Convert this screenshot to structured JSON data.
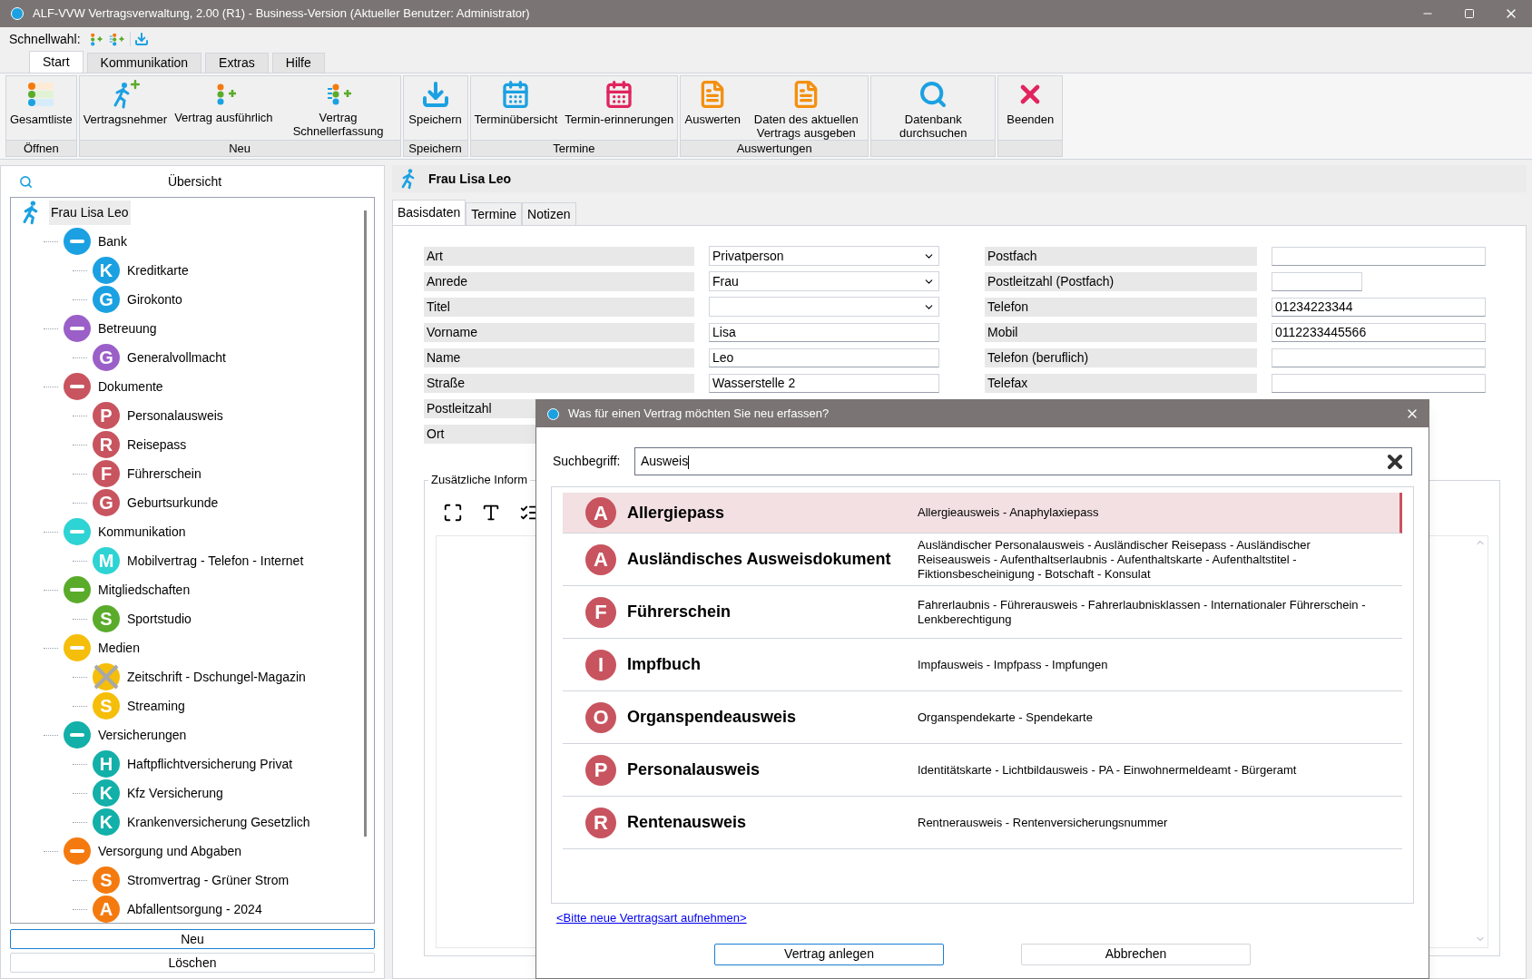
{
  "window": {
    "title": "ALF-VVW Vertragsverwaltung, 2.00 (R1) - Business-Version (Aktueller Benutzer: Administrator)"
  },
  "quickbar": {
    "label": "Schnellwahl:"
  },
  "ribbon_tabs": [
    {
      "label": "Start",
      "selected": true
    },
    {
      "label": "Kommunikation",
      "selected": false
    },
    {
      "label": "Extras",
      "selected": false
    },
    {
      "label": "Hilfe",
      "selected": false
    }
  ],
  "ribbon_groups": [
    {
      "label": "Öffnen",
      "buttons": [
        {
          "kind": "list",
          "label": "Gesamtliste"
        }
      ]
    },
    {
      "label": "Neu",
      "buttons": [
        {
          "kind": "person",
          "label": "Vertragsnehmer"
        },
        {
          "kind": "add",
          "label": "Vertrag ausführlich"
        },
        {
          "kind": "fastadd",
          "label": "Vertrag Schnellerfassung"
        }
      ]
    },
    {
      "label": "Speichern",
      "buttons": [
        {
          "kind": "save",
          "label": "Speichern"
        }
      ]
    },
    {
      "label": "Termine",
      "buttons": [
        {
          "kind": "calendar",
          "label": "Terminübersicht"
        },
        {
          "kind": "reminder",
          "label": "Termin-erinnerungen"
        }
      ]
    },
    {
      "label": "Auswertungen",
      "buttons": [
        {
          "kind": "doc",
          "label": "Auswerten"
        },
        {
          "kind": "doc",
          "label": "Daten des aktuellen Vertrags ausgeben"
        }
      ]
    },
    {
      "buttons": [
        {
          "kind": "search",
          "label": "Datenbank durchsuchen"
        }
      ]
    },
    {
      "buttons": [
        {
          "kind": "close",
          "label": "Beenden"
        }
      ]
    }
  ],
  "sidebar": {
    "title": "Übersicht",
    "root": {
      "label": "Frau Lisa Leo",
      "selected": true
    },
    "categories": [
      {
        "label": "Bank",
        "color": "#1ba1e2",
        "selected": false,
        "children": [
          {
            "letter": "K",
            "label": "Kreditkarte",
            "cancelled": false,
            "selected": false
          },
          {
            "letter": "G",
            "label": "Girokonto",
            "cancelled": false,
            "selected": false
          }
        ]
      },
      {
        "label": "Betreuung",
        "color": "#9b5fc8",
        "selected": false,
        "children": [
          {
            "letter": "G",
            "label": "Generalvollmacht",
            "cancelled": false,
            "selected": false
          }
        ]
      },
      {
        "label": "Dokumente",
        "color": "#c8545f",
        "selected": false,
        "children": [
          {
            "letter": "P",
            "label": "Personalausweis",
            "cancelled": false,
            "selected": false
          },
          {
            "letter": "R",
            "label": "Reisepass",
            "cancelled": false,
            "selected": false
          },
          {
            "letter": "F",
            "label": "Führerschein",
            "cancelled": false,
            "selected": false
          },
          {
            "letter": "G",
            "label": "Geburtsurkunde",
            "cancelled": false,
            "selected": false
          }
        ]
      },
      {
        "label": "Kommunikation",
        "color": "#2ed3d3",
        "selected": false,
        "children": [
          {
            "letter": "M",
            "label": "Mobilvertrag - Telefon - Internet",
            "cancelled": false,
            "selected": false
          }
        ]
      },
      {
        "label": "Mitgliedschaften",
        "color": "#5aab2a",
        "selected": false,
        "children": [
          {
            "letter": "S",
            "label": "Sportstudio",
            "cancelled": false,
            "selected": false
          }
        ]
      },
      {
        "label": "Medien",
        "color": "#f5be0a",
        "selected": false,
        "children": [
          {
            "label": "Zeitschrift - Dschungel-Magazin",
            "cancelled": true,
            "selected": false
          },
          {
            "letter": "S",
            "label": "Streaming",
            "cancelled": false,
            "selected": false
          }
        ]
      },
      {
        "label": "Versicherungen",
        "color": "#12b0a8",
        "selected": false,
        "children": [
          {
            "letter": "H",
            "label": "Haftpflichtversicherung Privat",
            "cancelled": false,
            "selected": false
          },
          {
            "letter": "K",
            "label": "Kfz Versicherung",
            "cancelled": false,
            "selected": false
          },
          {
            "letter": "K",
            "label": "Krankenversicherung Gesetzlich",
            "cancelled": false,
            "selected": false
          }
        ]
      },
      {
        "label": "Versorgung und Abgaben",
        "color": "#f47a0f",
        "selected": false,
        "children": [
          {
            "letter": "S",
            "label": "Stromvertrag - Grüner Strom",
            "cancelled": false,
            "selected": false
          },
          {
            "letter": "A",
            "label": "Abfallentsorgung - 2024",
            "cancelled": false,
            "selected": false
          }
        ]
      }
    ],
    "buttons": [
      "Neu",
      "Löschen"
    ]
  },
  "detail": {
    "title": "Frau Lisa Leo",
    "tabs": [
      {
        "label": "Basisdaten",
        "selected": true
      },
      {
        "label": "Termine",
        "selected": false
      },
      {
        "label": "Notizen",
        "selected": false
      }
    ],
    "left_fields": [
      {
        "label": "Art",
        "kind": "combo",
        "value": "Privatperson"
      },
      {
        "label": "Anrede",
        "kind": "combo",
        "value": "Frau"
      },
      {
        "label": "Titel",
        "kind": "combo"
      },
      {
        "label": "Vorname",
        "kind": "text",
        "value": "Lisa"
      },
      {
        "label": "Name",
        "kind": "text",
        "value": "Leo"
      },
      {
        "label": "Straße",
        "kind": "text",
        "value": "Wasserstelle 2"
      },
      {
        "label": "Postleitzahl",
        "kind": "hidden"
      },
      {
        "label": "Ort",
        "kind": "hidden"
      }
    ],
    "right_fields": [
      {
        "label": "Postfach",
        "kind": "text"
      },
      {
        "label": "Postleitzahl (Postfach)",
        "kind": "short"
      },
      {
        "label": "Telefon",
        "kind": "text",
        "value": "01234223344"
      },
      {
        "label": "Mobil",
        "kind": "text",
        "value": "0112233445566"
      },
      {
        "label": "Telefon (beruflich)",
        "kind": "text"
      },
      {
        "label": "Telefax",
        "kind": "text"
      }
    ],
    "notes_group": "Zusätzliche Inform"
  },
  "dialog": {
    "title": "Was für einen Vertrag möchten Sie neu erfassen?",
    "search_label": "Suchbegriff:",
    "search_value": "Ausweis",
    "results": [
      {
        "letter": "A",
        "name": "Allergiepass",
        "synonyms": "Allergieausweis - Anaphylaxiepass",
        "selected": true
      },
      {
        "letter": "A",
        "name": "Ausländisches Ausweisdokument",
        "synonyms": "Ausländischer Personalausweis - Ausländischer Reisepass - Ausländischer Reiseausweis - Aufenthaltserlaubnis - Aufenthaltskarte - Aufenthaltstitel - Fiktionsbescheinigung - Botschaft - Konsulat",
        "selected": false
      },
      {
        "letter": "F",
        "name": "Führerschein",
        "synonyms": "Fahrerlaubnis - Führerausweis - Fahrerlaubnisklassen - Internationaler Führerschein - Lenkberechtigung",
        "selected": false
      },
      {
        "letter": "I",
        "name": "Impfbuch",
        "synonyms": "Impfausweis - Impfpass - Impfungen",
        "selected": false
      },
      {
        "letter": "O",
        "name": "Organspendeausweis",
        "synonyms": "Organspendekarte - Spendekarte",
        "selected": false
      },
      {
        "letter": "P",
        "name": "Personalausweis",
        "synonyms": "Identitätskarte - Lichtbildausweis - PA - Einwohnermeldeamt - Bürgeramt",
        "selected": false
      },
      {
        "letter": "R",
        "name": "Rentenausweis",
        "synonyms": "Rentnerausweis - Rentenversicherungsnummer",
        "selected": false
      }
    ],
    "link": "<Bitte neue Vertragsart aufnehmen>",
    "buttons": [
      "Vertrag anlegen",
      "Abbrechen"
    ]
  }
}
